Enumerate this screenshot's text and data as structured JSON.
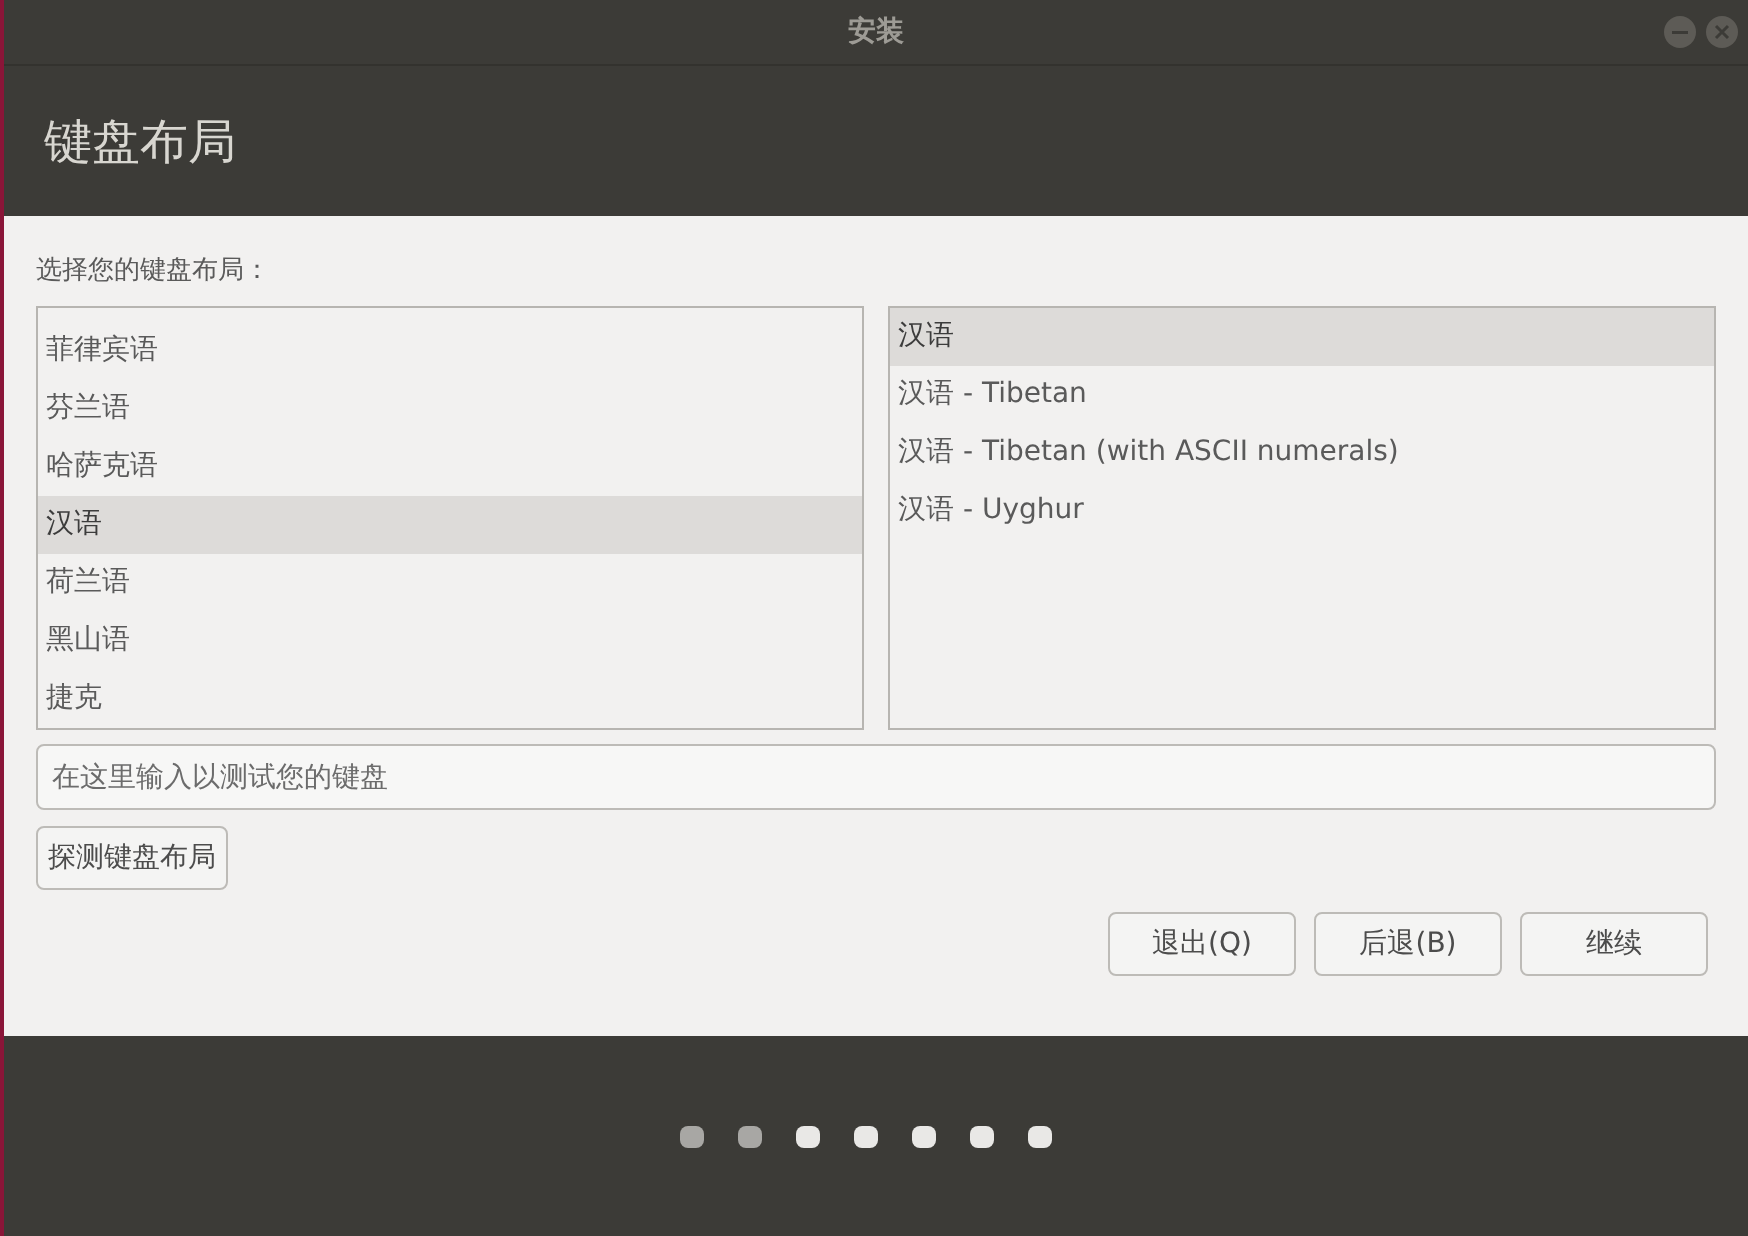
{
  "window": {
    "title": "安装"
  },
  "header": {
    "title": "键盘布局"
  },
  "prompt": "选择您的键盘布局：",
  "layouts": [
    {
      "label": "菲律宾语",
      "selected": false
    },
    {
      "label": "芬兰语",
      "selected": false
    },
    {
      "label": "哈萨克语",
      "selected": false
    },
    {
      "label": "汉语",
      "selected": true
    },
    {
      "label": "荷兰语",
      "selected": false
    },
    {
      "label": "黑山语",
      "selected": false
    },
    {
      "label": "捷克",
      "selected": false
    }
  ],
  "variants": [
    {
      "label": "汉语",
      "selected": true
    },
    {
      "label": "汉语 - Tibetan",
      "selected": false
    },
    {
      "label": "汉语 - Tibetan (with ASCII numerals)",
      "selected": false
    },
    {
      "label": "汉语 - Uyghur",
      "selected": false
    }
  ],
  "test_field": {
    "placeholder": "在这里输入以测试您的键盘"
  },
  "detect_button": "探测键盘布局",
  "buttons": [
    "退出(Q)",
    "后退(B)",
    "继续"
  ],
  "progress": [
    {
      "done": true
    },
    {
      "done": true
    },
    {
      "done": false
    },
    {
      "done": false
    },
    {
      "done": false
    },
    {
      "done": false
    },
    {
      "done": false
    }
  ]
}
